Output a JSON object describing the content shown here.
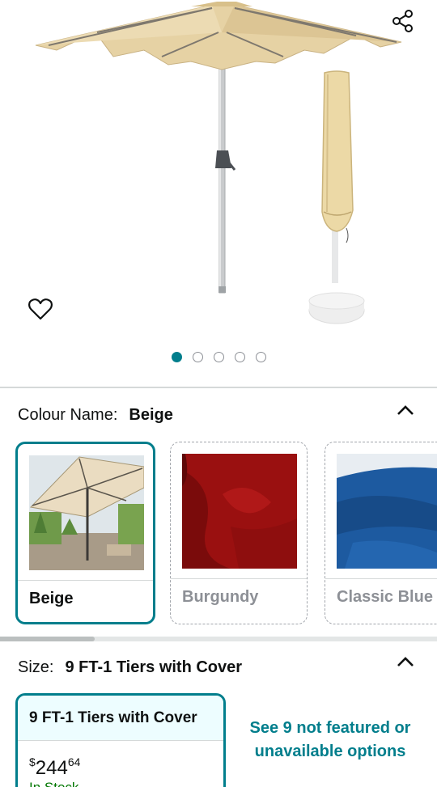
{
  "gallery": {
    "image_count": 5,
    "active_index": 0,
    "icons": {
      "share": "share-icon",
      "wishlist": "heart-outline-icon"
    }
  },
  "colour": {
    "label": "Colour Name:",
    "selected": "Beige",
    "options": [
      {
        "label": "Beige",
        "state": "selected",
        "color": "#e8dcc2"
      },
      {
        "label": "Burgundy",
        "state": "unavailable",
        "color": "#8f0f0f"
      },
      {
        "label": "Classic Blue",
        "state": "unavailable",
        "color": "#1d5aa0"
      }
    ]
  },
  "size": {
    "label": "Size:",
    "selected": "9 FT-1 Tiers with Cover",
    "option": {
      "label": "9 FT-1 Tiers with Cover",
      "price_symbol": "$",
      "price_whole": "244",
      "price_fraction": "64",
      "stock": "In Stock"
    },
    "more_link": "See 9 not featured or unavailable options"
  },
  "colors": {
    "accent": "#017e8c",
    "selected_bg": "#edfdff",
    "stock": "#007600",
    "canopy": "#e8d3a6"
  }
}
